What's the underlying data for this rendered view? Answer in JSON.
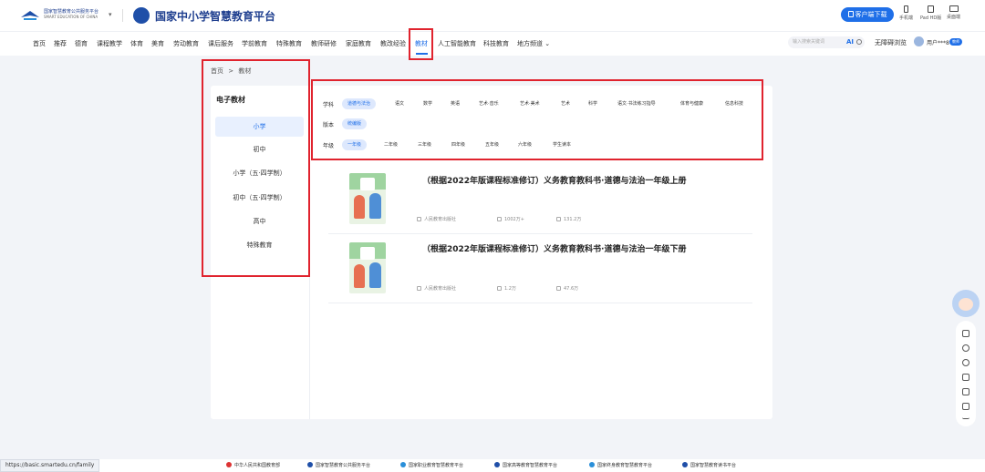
{
  "header": {
    "logo_primary_line1": "国家智慧教育公共服务平台",
    "logo_primary_line2": "SMART EDUCATION OF CHINA",
    "logo_secondary": "国家中小学智慧教育平台",
    "download_label": "客户端下载",
    "devices": [
      "手机端",
      "Pad HD版",
      "桌面端"
    ]
  },
  "nav": {
    "items": [
      "首页",
      "推荐",
      "德育",
      "课程教学",
      "体育",
      "美育",
      "劳动教育",
      "课后服务",
      "学前教育",
      "特殊教育",
      "教师研修",
      "家庭教育",
      "教改经验",
      "教材",
      "人工智能教育",
      "科技教育",
      "地方频道"
    ],
    "active": "教材",
    "search_placeholder": "输入搜索关键词",
    "search_ai": "AI",
    "barrier_free": "无障碍浏览",
    "user_name": "用户***8",
    "user_badge": "教师"
  },
  "breadcrumb": {
    "home": "首页",
    "sep": ">",
    "current": "教材"
  },
  "sidebar": {
    "title": "电子教材",
    "items": [
      "小学",
      "初中",
      "小学（五·四学制）",
      "初中（五·四学制）",
      "高中",
      "特殊教育"
    ],
    "active": "小学"
  },
  "filters": {
    "subject_label": "学科",
    "subjects": [
      "道德与法治",
      "语文",
      "数学",
      "英语",
      "艺术·音乐",
      "艺术·美术",
      "艺术",
      "科学",
      "语文·书法练习指导",
      "体育与健康",
      "信息科技"
    ],
    "subject_active": "道德与法治",
    "edition_label": "版本",
    "editions": [
      "统编版"
    ],
    "grade_label": "年级",
    "grades": [
      "一年级",
      "二年级",
      "三年级",
      "四年级",
      "五年级",
      "六年级",
      "学生读本"
    ],
    "grade_active": "一年级"
  },
  "books": [
    {
      "title": "（根据2022年版课程标准修订）义务教育教科书·道德与法治一年级上册",
      "publisher": "人民教育出版社",
      "likes": "1002万+",
      "views": "131.2万"
    },
    {
      "title": "（根据2022年版课程标准修订）义务教育教科书·道德与法治一年级下册",
      "publisher": "人民教育出版社",
      "likes": "1.2万",
      "views": "47.6万"
    }
  ],
  "footer": {
    "links": [
      "中华人民共和国教育部",
      "国家智慧教育公共服务平台",
      "国家职业教育智慧教育平台",
      "国家高等教育智慧教育平台",
      "国家终身教育智慧教育平台",
      "国家智慧教育读书平台"
    ],
    "status_url": "https://basic.smartedu.cn/family"
  },
  "colors": {
    "accent": "#1f6fe8",
    "highlight_box": "#e0232e",
    "background": "#f2f4f8"
  }
}
